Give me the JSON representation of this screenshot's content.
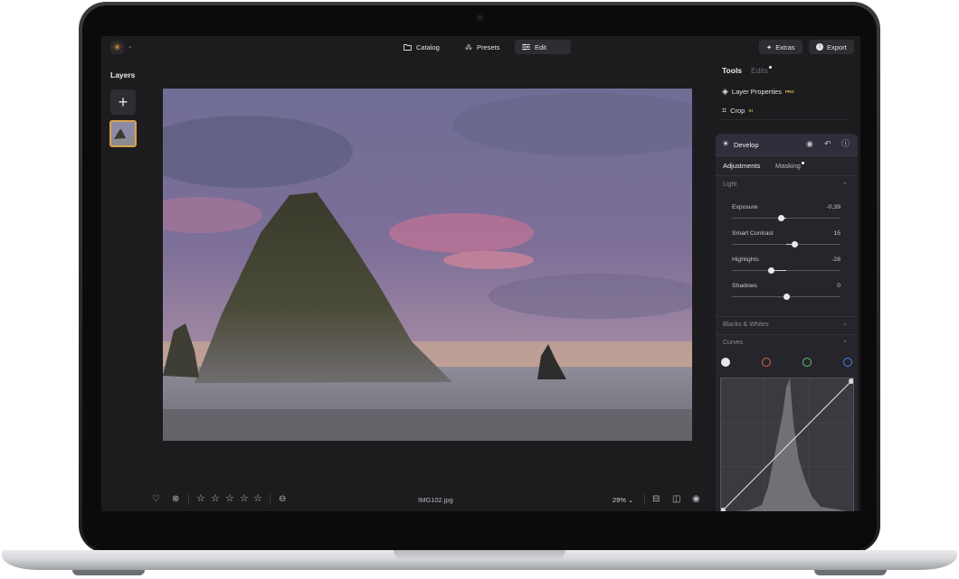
{
  "topbar": {
    "nav": [
      {
        "label": "Catalog",
        "icon": "folder-icon"
      },
      {
        "label": "Presets",
        "icon": "wand-icon"
      },
      {
        "label": "Edit",
        "icon": "sliders-icon",
        "active": true
      }
    ],
    "extras_label": "Extras",
    "export_label": "Export"
  },
  "layers": {
    "title": "Layers"
  },
  "bottombar": {
    "filename": "IMG102.jpg",
    "zoom": "29%",
    "rating": 0,
    "max_rating": 5
  },
  "tools": {
    "tabs": {
      "tools": "Tools",
      "edits": "Edits"
    },
    "items": [
      {
        "label": "Layer Properties",
        "badge": "PRO",
        "icon": "layers-icon"
      },
      {
        "label": "Crop",
        "badge": "AI",
        "icon": "crop-icon"
      }
    ]
  },
  "develop": {
    "title": "Develop",
    "subtabs": {
      "adjustments": "Adjustments",
      "masking": "Masking"
    },
    "light": {
      "section": "Light",
      "sliders": [
        {
          "label": "Exposure",
          "value": "-0,39",
          "position": 0.45
        },
        {
          "label": "Smart Contrast",
          "value": "15",
          "position": 0.58
        },
        {
          "label": "Highlights",
          "value": "-28",
          "position": 0.36
        },
        {
          "label": "Shadows",
          "value": "0",
          "position": 0.5
        }
      ]
    },
    "blacks_whites": {
      "section": "Blacks & Whites"
    },
    "curves": {
      "section": "Curves",
      "channels": [
        {
          "name": "rgb",
          "color": "#e8e8ea"
        },
        {
          "name": "red",
          "color": "#e0644f"
        },
        {
          "name": "green",
          "color": "#5fc46a"
        },
        {
          "name": "blue",
          "color": "#4a7ff0"
        }
      ]
    }
  },
  "colors": {
    "accent": "#d9a24a",
    "panel": "#25252b",
    "background": "#1c1c1e"
  }
}
